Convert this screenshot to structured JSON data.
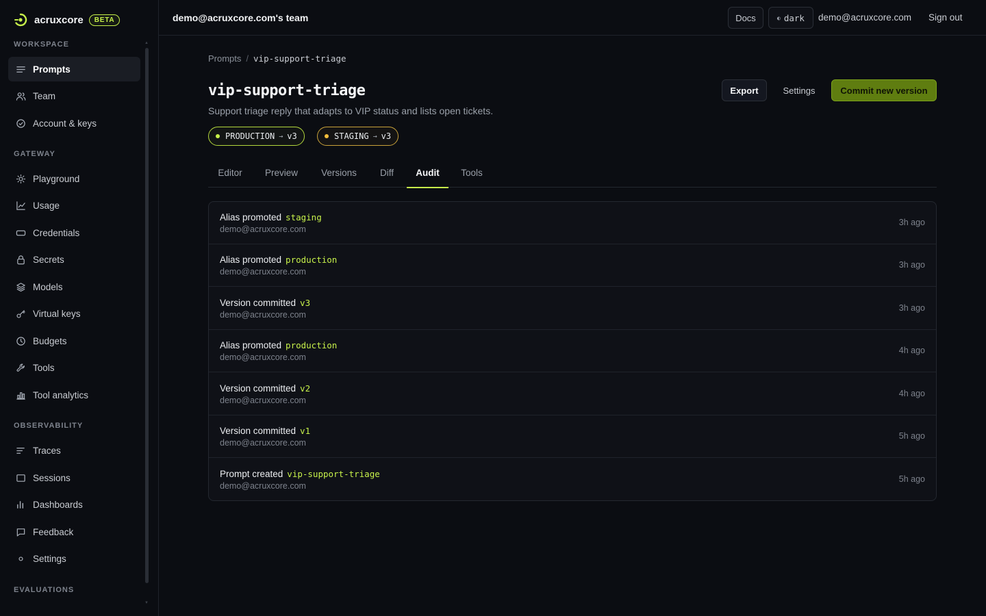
{
  "brand": {
    "name": "acruxcore",
    "badge": "BETA"
  },
  "sidebar": {
    "sections": [
      {
        "label": "WORKSPACE"
      },
      {
        "label": "GATEWAY"
      },
      {
        "label": "OBSERVABILITY"
      },
      {
        "label": "EVALUATIONS"
      }
    ],
    "items": [
      {
        "label": "Prompts",
        "icon": "lines-icon",
        "active": true
      },
      {
        "label": "Team",
        "icon": "users-icon"
      },
      {
        "label": "Account & keys",
        "icon": "check-circle-icon"
      },
      {
        "label": "Playground",
        "icon": "sun-icon"
      },
      {
        "label": "Usage",
        "icon": "chart-line-icon"
      },
      {
        "label": "Credentials",
        "icon": "card-icon"
      },
      {
        "label": "Secrets",
        "icon": "lock-icon"
      },
      {
        "label": "Models",
        "icon": "layers-icon"
      },
      {
        "label": "Virtual keys",
        "icon": "key-icon"
      },
      {
        "label": "Budgets",
        "icon": "clock-icon"
      },
      {
        "label": "Tools",
        "icon": "wrench-icon"
      },
      {
        "label": "Tool analytics",
        "icon": "bar-chart-icon"
      },
      {
        "label": "Traces",
        "icon": "traces-icon"
      },
      {
        "label": "Sessions",
        "icon": "window-icon"
      },
      {
        "label": "Dashboards",
        "icon": "dashboard-icon"
      },
      {
        "label": "Feedback",
        "icon": "message-icon"
      },
      {
        "label": "Settings",
        "icon": "gear-icon"
      }
    ]
  },
  "topbar": {
    "team": "demo@acruxcore.com's team",
    "docs": "Docs",
    "theme": "dark",
    "email": "demo@acruxcore.com",
    "sign_out": "Sign out"
  },
  "page": {
    "breadcrumb": {
      "root": "Prompts",
      "sep": "/",
      "current": "vip-support-triage"
    },
    "title": "vip-support-triage",
    "description": "Support triage reply that adapts to VIP status and lists open tickets.",
    "aliases": [
      {
        "name": "PRODUCTION",
        "arrow": "→",
        "version": "v3",
        "color": "#c6f04a"
      },
      {
        "name": "STAGING",
        "arrow": "→",
        "version": "v3",
        "color": "#f5be3c"
      }
    ],
    "actions": {
      "export": "Export",
      "settings": "Settings",
      "commit": "Commit new version"
    },
    "tabs": [
      "Editor",
      "Preview",
      "Versions",
      "Diff",
      "Audit",
      "Tools"
    ],
    "active_tab": "Audit"
  },
  "audit": [
    {
      "action": "Alias promoted",
      "target": "staging",
      "user": "demo@acruxcore.com",
      "time": "3h ago"
    },
    {
      "action": "Alias promoted",
      "target": "production",
      "user": "demo@acruxcore.com",
      "time": "3h ago"
    },
    {
      "action": "Version committed",
      "target": "v3",
      "user": "demo@acruxcore.com",
      "time": "3h ago"
    },
    {
      "action": "Alias promoted",
      "target": "production",
      "user": "demo@acruxcore.com",
      "time": "4h ago"
    },
    {
      "action": "Version committed",
      "target": "v2",
      "user": "demo@acruxcore.com",
      "time": "4h ago"
    },
    {
      "action": "Version committed",
      "target": "v1",
      "user": "demo@acruxcore.com",
      "time": "5h ago"
    },
    {
      "action": "Prompt created",
      "target": "vip-support-triage",
      "user": "demo@acruxcore.com",
      "time": "5h ago"
    }
  ],
  "colors": {
    "accent": "#c6f04a",
    "commit_bg": "#5f7d10",
    "staging": "#f5be3c"
  }
}
